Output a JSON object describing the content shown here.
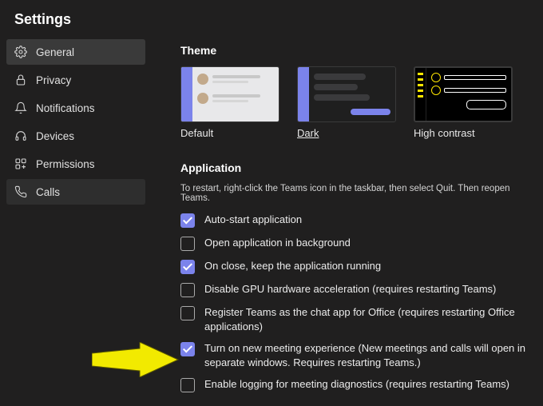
{
  "title": "Settings",
  "sidebar": {
    "items": [
      {
        "label": "General"
      },
      {
        "label": "Privacy"
      },
      {
        "label": "Notifications"
      },
      {
        "label": "Devices"
      },
      {
        "label": "Permissions"
      },
      {
        "label": "Calls"
      }
    ]
  },
  "theme": {
    "heading": "Theme",
    "options": [
      {
        "label": "Default"
      },
      {
        "label": "Dark"
      },
      {
        "label": "High contrast"
      }
    ]
  },
  "application": {
    "heading": "Application",
    "note": "To restart, right-click the Teams icon in the taskbar, then select Quit. Then reopen Teams.",
    "items": [
      {
        "label": "Auto-start application",
        "checked": true
      },
      {
        "label": "Open application in background",
        "checked": false
      },
      {
        "label": "On close, keep the application running",
        "checked": true
      },
      {
        "label": "Disable GPU hardware acceleration (requires restarting Teams)",
        "checked": false
      },
      {
        "label": "Register Teams as the chat app for Office (requires restarting Office applications)",
        "checked": false
      },
      {
        "label": "Turn on new meeting experience (New meetings and calls will open in separate windows. Requires restarting Teams.)",
        "checked": true
      },
      {
        "label": "Enable logging for meeting diagnostics (requires restarting Teams)",
        "checked": false
      }
    ]
  }
}
